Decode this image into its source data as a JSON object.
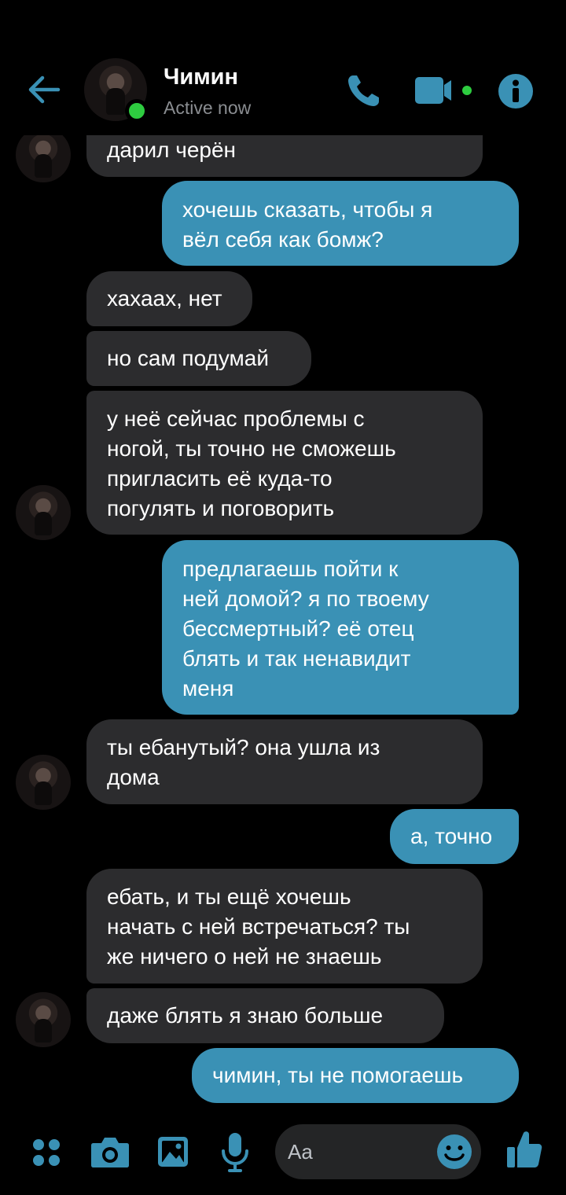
{
  "header": {
    "name": "Чимин",
    "status": "Active now"
  },
  "colors": {
    "accent": "#3a91b5",
    "incoming_bubble": "#2c2c2e",
    "online": "#2ecc40"
  },
  "messages": [
    {
      "dir": "in",
      "text": "дарил черён"
    },
    {
      "dir": "out",
      "text": "хочешь сказать, чтобы я\nвёл себя как бомж?"
    },
    {
      "dir": "in",
      "text": "хахаах, нет"
    },
    {
      "dir": "in",
      "text": "но сам подумай"
    },
    {
      "dir": "in",
      "text": "у неё сейчас проблемы с\nногой, ты точно не сможешь\nпригласить её куда-то\nпогулять и поговорить"
    },
    {
      "dir": "out",
      "text": "предлагаешь пойти к\nней домой? я по твоему\nбессмертный? её отец\nблять и так ненавидит\nменя"
    },
    {
      "dir": "in",
      "text": "ты ебанутый? она ушла из\nдома"
    },
    {
      "dir": "out",
      "text": "а, точно"
    },
    {
      "dir": "in",
      "text": "ебать, и ты ещё хочешь\nначать с ней встречаться? ты\nже ничего о ней не знаешь"
    },
    {
      "dir": "in",
      "text": "даже блять я знаю больше"
    },
    {
      "dir": "out",
      "text": "чимин, ты не помогаешь"
    }
  ],
  "composer": {
    "placeholder": "Aa"
  },
  "icons": [
    "back-arrow-icon",
    "phone-icon",
    "video-camera-icon",
    "info-icon",
    "menu-dots-icon",
    "camera-icon",
    "gallery-icon",
    "microphone-icon",
    "emoji-icon",
    "thumbs-up-icon"
  ]
}
